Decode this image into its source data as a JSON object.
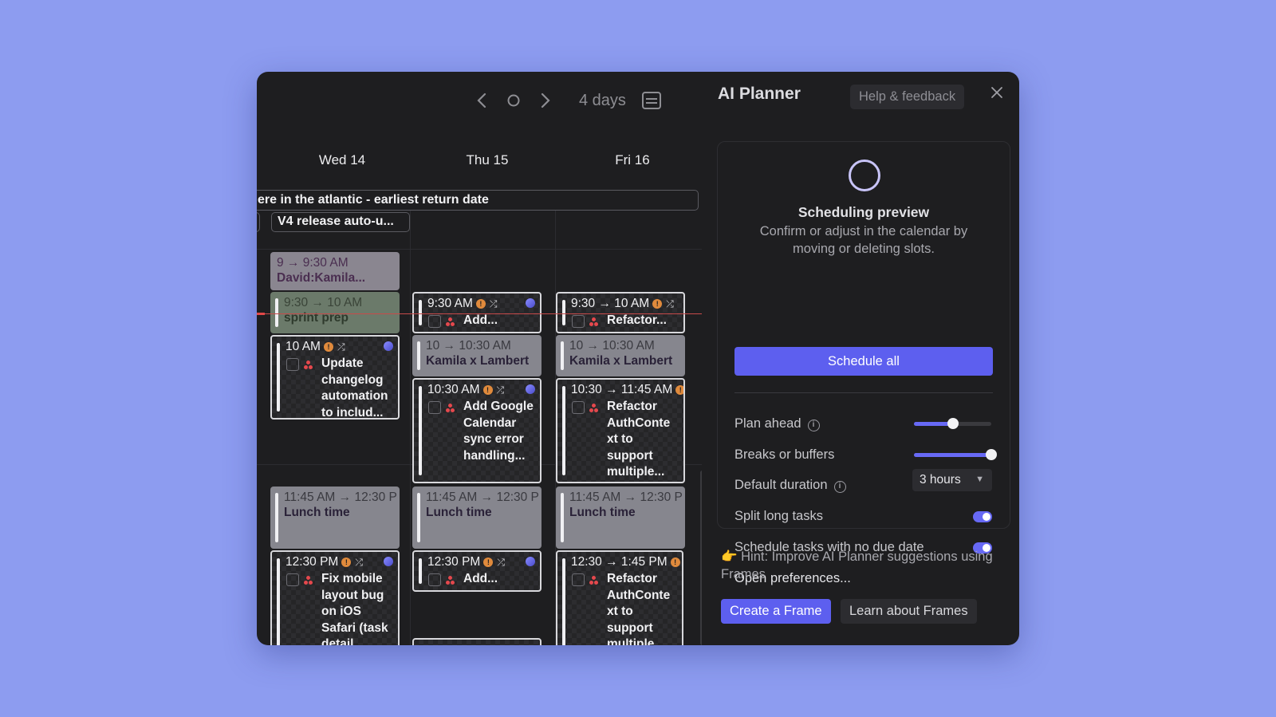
{
  "nav": {
    "range_label": "4 days"
  },
  "days": [
    "Wed 14",
    "Thu 15",
    "Fri 16"
  ],
  "all_day": {
    "long_event": "ere in the atlantic - earliest return date",
    "chip": "V4 release auto-u..."
  },
  "events": {
    "david": {
      "time": "9 → 9:30 AM",
      "title": "David:Kamila..."
    },
    "sprint": {
      "time": "9:30 → 10 AM",
      "title": "sprint prep"
    },
    "thu_add1": {
      "time": "9:30 AM",
      "title": "Add..."
    },
    "fri_refactor1": {
      "time": "9:30 → 10 AM",
      "title": "Refactor..."
    },
    "wed_update": {
      "time": "10 AM",
      "title": "Update changelog automation to includ..."
    },
    "thu_kl": {
      "time": "10 → 10:30 AM",
      "title": "Kamila x Lambert"
    },
    "fri_kl": {
      "time": "10 → 10:30 AM",
      "title": "Kamila x Lambert"
    },
    "thu_google": {
      "time": "10:30 AM",
      "title": "Add Google Calendar sync error handling..."
    },
    "fri_refactor2": {
      "time": "10:30 → 11:45 AM",
      "title": "Refactor AuthConte xt to support multiple..."
    },
    "lunch_wed": {
      "time": "11:45 AM → 12:30 P",
      "title": "Lunch time"
    },
    "lunch_thu": {
      "time": "11:45 AM → 12:30 P",
      "title": "Lunch time"
    },
    "lunch_fri": {
      "time": "11:45 AM → 12:30 P",
      "title": "Lunch time"
    },
    "wed_fix": {
      "time": "12:30 PM",
      "title": "Fix mobile layout bug on iOS Safari (task detail"
    },
    "thu_add2": {
      "time": "12:30 PM",
      "title": "Add..."
    },
    "fri_refactor3": {
      "time": "12:30 → 1:45 PM",
      "title": "Refactor AuthConte xt to support multiple..."
    }
  },
  "panel": {
    "title": "AI Planner",
    "help_label": "Help & feedback",
    "preview_title": "Scheduling preview",
    "preview_sub": "Confirm or adjust in the calendar by moving or deleting slots.",
    "schedule_all": "Schedule all",
    "plan_ahead": "Plan ahead",
    "plan_ahead_value": 0.5,
    "breaks": "Breaks or buffers",
    "breaks_value": 1.0,
    "default_duration": "Default duration",
    "default_duration_value": "3 hours",
    "split_long": "Split long tasks",
    "split_long_on": true,
    "no_due": "Schedule tasks with no due date",
    "no_due_on": true,
    "open_prefs": "Open preferences...",
    "hint": "👉 Hint: Improve AI Planner suggestions using Frames",
    "create_frame": "Create a Frame",
    "learn_frames": "Learn about Frames"
  },
  "colors": {
    "accent": "#5d5fef",
    "background": "#8d9cf0",
    "window": "#1e1e20",
    "now_line": "#e24848"
  }
}
